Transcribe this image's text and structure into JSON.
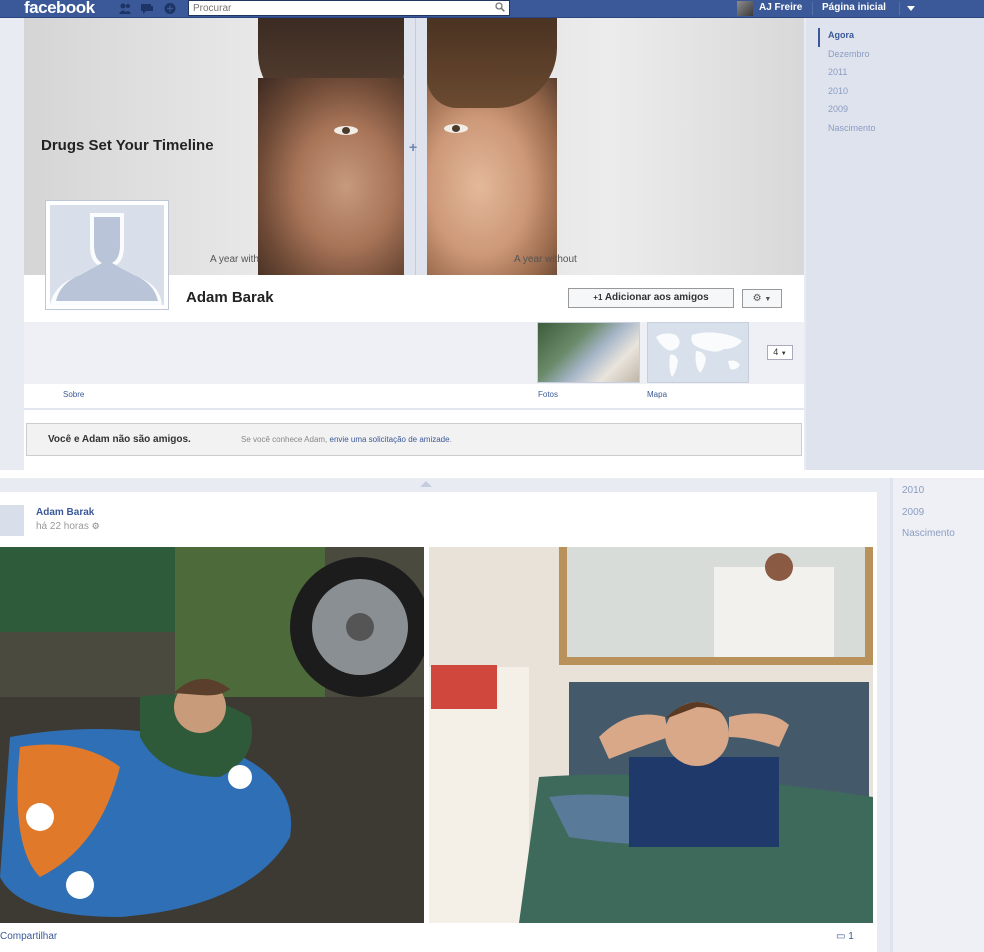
{
  "topbar": {
    "logo": "facebook",
    "search_placeholder": "Procurar",
    "user_name": "AJ Freire",
    "home_label": "Página inicial"
  },
  "cover": {
    "title": "Drugs Set Your Timeline",
    "caption_left": "A year with",
    "caption_right": "A year without"
  },
  "profile": {
    "name": "Adam Barak",
    "add_friend_label": "Adicionar aos amigos",
    "add_friend_prefix": "+1",
    "more_count": "4"
  },
  "sections": {
    "about": "Sobre",
    "photos": "Fotos",
    "map": "Mapa"
  },
  "notice": {
    "bold": "Você e Adam não são amigos.",
    "rest_prefix": "Se você conhece Adam,",
    "rest_link": "envie uma solicitação de amizade"
  },
  "timeline_years": [
    "Agora",
    "Dezembro",
    "2011",
    "2010",
    "2009",
    "Nascimento"
  ],
  "timeline_years_lower": [
    "2010",
    "2009",
    "Nascimento"
  ],
  "post": {
    "author": "Adam Barak",
    "time": "há 22 horas",
    "share": "Compartilhar",
    "comments": "1"
  },
  "colors": {
    "brand": "#3b5998",
    "timeline_bg": "#dfe3ee",
    "link": "#3b5998"
  }
}
